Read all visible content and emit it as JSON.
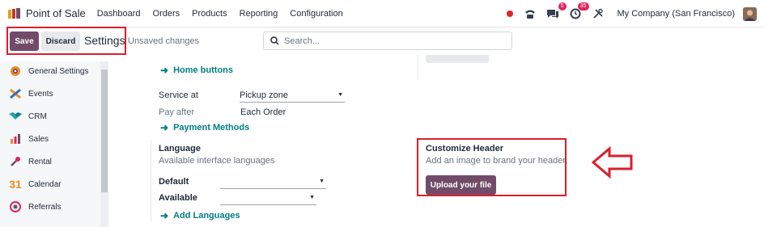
{
  "navbar": {
    "brand": "Point of Sale",
    "menu": [
      "Dashboard",
      "Orders",
      "Products",
      "Reporting",
      "Configuration"
    ],
    "messages_badge": "5",
    "activities_badge": "35",
    "company": "My Company (San Francisco)",
    "icons": [
      "apps-icon",
      "phone-icon",
      "chat-icon",
      "clock-icon",
      "tools-icon"
    ]
  },
  "control": {
    "save_label": "Save",
    "discard_label": "Discard",
    "title": "Settings",
    "status": "Unsaved changes",
    "search_placeholder": "Search..."
  },
  "sidebar": {
    "items": [
      {
        "label": "General Settings",
        "icon": "gear-multicolor-icon"
      },
      {
        "label": "Events",
        "icon": "events-icon"
      },
      {
        "label": "CRM",
        "icon": "crm-handshake-icon"
      },
      {
        "label": "Sales",
        "icon": "sales-chart-icon"
      },
      {
        "label": "Rental",
        "icon": "rental-key-icon"
      },
      {
        "label": "Calendar",
        "icon": "calendar-31-icon"
      },
      {
        "label": "Referrals",
        "icon": "referrals-icon"
      }
    ],
    "calendar_glyph": "31"
  },
  "main": {
    "home_buttons_link": "Home buttons",
    "service_at_label": "Service at",
    "service_at_value": "Pickup zone",
    "pay_after_label": "Pay after",
    "pay_after_value": "Each Order",
    "payment_methods_link": "Payment Methods",
    "language_title": "Language",
    "language_desc": "Available interface languages",
    "default_label": "Default",
    "available_label": "Available",
    "add_languages_link": "Add Languages",
    "customize_title": "Customize Header",
    "customize_desc": "Add an image to brand your header.",
    "upload_label": "Upload your file"
  },
  "colors": {
    "primary": "#714b67",
    "link": "#017e84",
    "annotation": "#dc1e2d"
  }
}
